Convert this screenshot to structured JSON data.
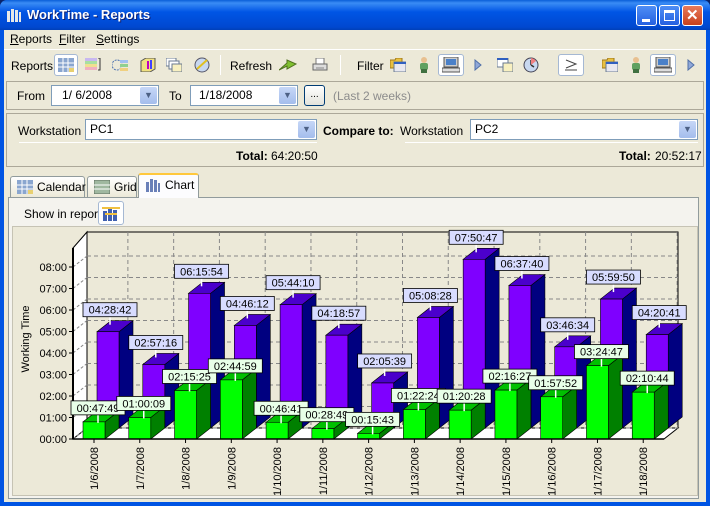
{
  "window": {
    "title": "WorkTime - Reports",
    "controls": [
      "minimize",
      "maximize",
      "close"
    ]
  },
  "menu": [
    {
      "label": "Reports",
      "accel": "R"
    },
    {
      "label": "Filter",
      "accel": "F"
    },
    {
      "label": "Settings",
      "accel": "S"
    }
  ],
  "toolbar": {
    "reports_label": "Reports",
    "report_icons": [
      "grid-report-icon",
      "list-report-icon",
      "timeline-report-icon",
      "chart-book-icon",
      "windows-report-icon",
      "globe-report-icon"
    ],
    "refresh_label": "Refresh",
    "refresh_icon": "refresh-arrow-icon",
    "print_icon": "printer-icon",
    "filter_label": "Filter",
    "filter_icons": [
      "folder-window-icon",
      "user-icon",
      "computer-icon",
      "play-arrow-icon",
      "window-list-icon",
      "clock-icon",
      "compare-icon",
      "folder-window-icon",
      "user-icon",
      "computer-icon",
      "play-arrow-icon"
    ]
  },
  "date_range": {
    "from_label": "From",
    "from_value": "1/ 6/2008",
    "to_label": "To",
    "to_value": "1/18/2008",
    "ellipsis_label": "...",
    "range_note": "(Last 2 weeks)"
  },
  "workstation": {
    "label": "Workstation",
    "value": "PC1",
    "total_label": "Total:",
    "total_value": "64:20:50"
  },
  "compare": {
    "label": "Compare to:",
    "workstation_label": "Workstation",
    "value": "PC2",
    "total_label": "Total:",
    "total_value": "20:52:17"
  },
  "tabs": [
    {
      "label": "Calendar",
      "active": false
    },
    {
      "label": "Grid",
      "active": false
    },
    {
      "label": "Chart",
      "active": true
    }
  ],
  "show_in_report_label": "Show in report",
  "colors": {
    "pc1_front": "#7f00ff",
    "pc1_side": "#000080",
    "pc1_top": "#4b00cc",
    "pc2_front": "#00ff00",
    "pc2_side": "#008000",
    "pc2_top": "#00c000",
    "pc1_label_bg": "#d8dcff",
    "pc2_label_bg": "#e8ffe8"
  },
  "chart_data": {
    "type": "bar",
    "style": "3d-grouped",
    "ylabel": "Working Time",
    "xlabel": "",
    "ylim": [
      0,
      8.5
    ],
    "yticks": [
      "00:00",
      "01:00",
      "02:00",
      "03:00",
      "04:00",
      "05:00",
      "06:00",
      "07:00",
      "08:00"
    ],
    "grid": true,
    "categories": [
      "1/6/2008",
      "1/7/2008",
      "1/8/2008",
      "1/9/2008",
      "1/10/2008",
      "1/11/2008",
      "1/12/2008",
      "1/13/2008",
      "1/14/2008",
      "1/15/2008",
      "1/16/2008",
      "1/17/2008",
      "1/18/2008"
    ],
    "series": [
      {
        "name": "PC1",
        "labels": [
          "04:28:42",
          "02:57:16",
          "06:15:54",
          "04:46:12",
          "05:44:10",
          "04:18:57",
          "02:05:39",
          "05:08:28",
          "07:50:47",
          "06:37:40",
          "03:46:34",
          "05:59:50",
          "04:20:41"
        ]
      },
      {
        "name": "PC2",
        "labels": [
          "00:47:49",
          "01:00:09",
          "02:15:25",
          "02:44:59",
          "00:46:41",
          "00:28:49",
          "00:15:43",
          "01:22:24",
          "01:20:28",
          "02:16:27",
          "01:57:52",
          "03:24:47",
          "02:10:44"
        ]
      }
    ]
  }
}
